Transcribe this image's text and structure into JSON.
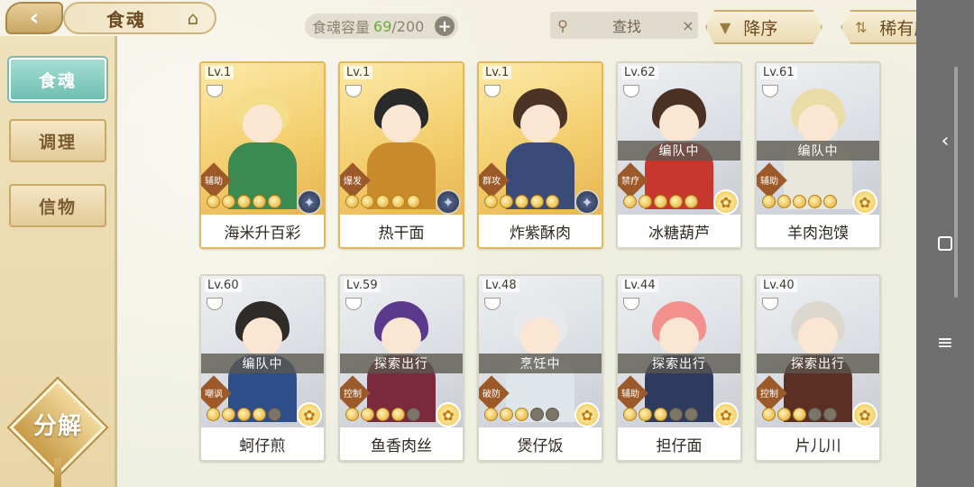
{
  "header": {
    "back_icon": "chevron-left-icon",
    "title": "食魂",
    "home_icon": "pavilion-icon",
    "capacity_label": "食魂容量",
    "capacity_current": "69",
    "capacity_max": "/200",
    "capacity_plus": "+",
    "search_label": "查找",
    "search_clear": "×",
    "sort_order_label": "降序",
    "sort_key_label": "稀有度"
  },
  "leftnav": {
    "items": [
      {
        "label": "食魂",
        "active": true
      },
      {
        "label": "调理",
        "active": false
      },
      {
        "label": "信物",
        "active": false
      }
    ],
    "decompose_label": "分解"
  },
  "cards": [
    {
      "level": "Lv.1",
      "name": "海米升百彩",
      "role": "辅助",
      "status": "",
      "stars": 5,
      "filled": 5,
      "frame": "gold",
      "badge": "dark",
      "hair": "#f4dd8a",
      "outfit": "#3b8a52"
    },
    {
      "level": "Lv.1",
      "name": "热干面",
      "role": "爆发",
      "status": "",
      "stars": 5,
      "filled": 5,
      "frame": "gold",
      "badge": "dark",
      "hair": "#2a2a2a",
      "outfit": "#c98a2b"
    },
    {
      "level": "Lv.1",
      "name": "炸紫酥肉",
      "role": "群攻",
      "status": "",
      "stars": 5,
      "filled": 5,
      "frame": "gold",
      "badge": "dark",
      "hair": "#4b3325",
      "outfit": "#3a4b7a"
    },
    {
      "level": "Lv.62",
      "name": "冰糖葫芦",
      "role": "禁疗",
      "status": "编队中",
      "stars": 5,
      "filled": 5,
      "frame": "silver",
      "badge": "flower",
      "hair": "#4a3124",
      "outfit": "#c7372d"
    },
    {
      "level": "Lv.61",
      "name": "羊肉泡馍",
      "role": "辅助",
      "status": "编队中",
      "stars": 5,
      "filled": 5,
      "frame": "silver",
      "badge": "flower",
      "hair": "#e9dca6",
      "outfit": "#e9e6dc"
    },
    {
      "level": "Lv.60",
      "name": "蚵仔煎",
      "role": "嘲讽",
      "status": "编队中",
      "stars": 5,
      "filled": 4,
      "frame": "silver",
      "badge": "flower",
      "hair": "#2e2b28",
      "outfit": "#2e4e8a"
    },
    {
      "level": "Lv.59",
      "name": "鱼香肉丝",
      "role": "控制",
      "status": "探索出行",
      "stars": 5,
      "filled": 4,
      "frame": "silver",
      "badge": "flower",
      "hair": "#5b3a8e",
      "outfit": "#7a2a3c"
    },
    {
      "level": "Lv.48",
      "name": "煲仔饭",
      "role": "破防",
      "status": "烹饪中",
      "stars": 5,
      "filled": 3,
      "frame": "silver",
      "badge": "flower",
      "hair": "#e8e9ec",
      "outfit": "#dfe6ea"
    },
    {
      "level": "Lv.44",
      "name": "担仔面",
      "role": "辅助",
      "status": "探索出行",
      "stars": 5,
      "filled": 3,
      "frame": "silver",
      "badge": "flower",
      "hair": "#f1908d",
      "outfit": "#2e3a5e"
    },
    {
      "level": "Lv.40",
      "name": "片儿川",
      "role": "控制",
      "status": "探索出行",
      "stars": 5,
      "filled": 3,
      "frame": "silver",
      "badge": "flower",
      "hair": "#dcd8cf",
      "outfit": "#5a2f24"
    }
  ],
  "system": {
    "back": "‹",
    "menu": "≡"
  }
}
